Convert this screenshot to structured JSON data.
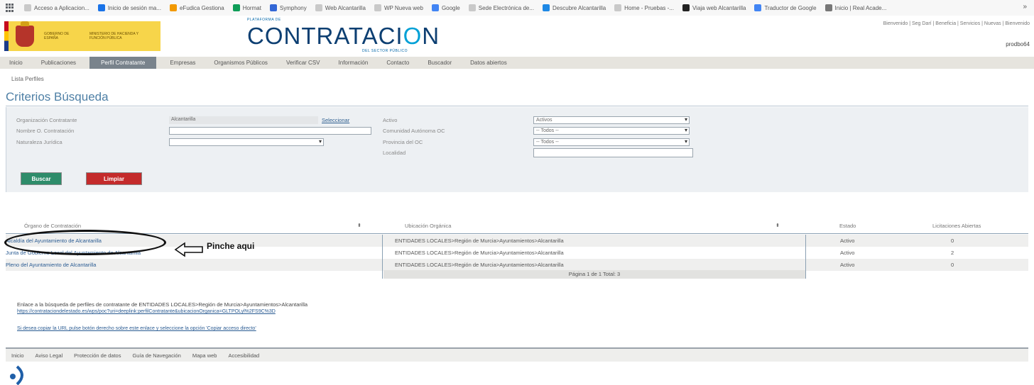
{
  "bookmarks": [
    {
      "label": "Acceso a Aplicacion...",
      "color": "#c9c9c9"
    },
    {
      "label": "Inicio de sesión ma...",
      "color": "#1a73e8"
    },
    {
      "label": "eFudica Gestiona",
      "color": "#f29900"
    },
    {
      "label": "Hormat",
      "color": "#0f9d58"
    },
    {
      "label": "Symphony",
      "color": "#3367d6"
    },
    {
      "label": "Web Alcantarilla",
      "color": "#c9c9c9"
    },
    {
      "label": "WP Nueva web",
      "color": "#c9c9c9"
    },
    {
      "label": "Google",
      "color": "#4285f4"
    },
    {
      "label": "Sede Electrónica de...",
      "color": "#c9c9c9"
    },
    {
      "label": "Descubre Alcantarilla",
      "color": "#1e88e5"
    },
    {
      "label": "Home - Pruebas -...",
      "color": "#c9c9c9"
    },
    {
      "label": "Viaja web Alcantarilla",
      "color": "#222222"
    },
    {
      "label": "Traductor de Google",
      "color": "#4285f4"
    },
    {
      "label": "Inicio | Real Acade...",
      "color": "#777777"
    }
  ],
  "header": {
    "gov_line1": "GOBIERNO DE ESPAÑA",
    "gov_line2": "MINISTERIO DE HACIENDA Y FUNCIÓN PÚBLICA",
    "brand_top": "PLATAFORMA DE",
    "brand_main_a": "CONTRATACI",
    "brand_main_o": "O",
    "brand_main_b": "N",
    "brand_sub": "DEL SECTOR PÚBLICO",
    "welcome": "Bienvenido | Seg Darí | Beneficia | Servicios | Nuevas | Bienvenido",
    "username": "prodbo64"
  },
  "nav": [
    "Inicio",
    "Publicaciones",
    "Perfil Contratante",
    "Empresas",
    "Organismos Públicos",
    "Verificar CSV",
    "Información",
    "Contacto",
    "Buscador",
    "Datos abiertos"
  ],
  "nav_active": "Perfil Contratante",
  "breadcrumb": "Lista Perfiles",
  "title": "Criterios Búsqueda",
  "form": {
    "org_label": "Organización Contratante",
    "org_value": "Alcantarilla",
    "select_link": "Seleccionar",
    "name_label": "Nombre O. Contratación",
    "nature_label": "Naturaleza Jurídica",
    "active_label": "Activo",
    "active_value": "Activos",
    "community_label": "Comunidad Autónoma OC",
    "community_value": "-- Todos --",
    "province_label": "Provincia del OC",
    "province_value": "-- Todos --",
    "locality_label": "Localidad",
    "search_button": "Buscar",
    "clear_button": "Limpiar"
  },
  "table": {
    "columns": [
      "Órgano de Contratación",
      "Ubicación Orgánica",
      "Estado",
      "Licitaciones Abiertas"
    ],
    "rows": [
      {
        "organo": "Alcaldía del Ayuntamiento de Alcantarilla",
        "ubicacion": "ENTIDADES LOCALES>Región de Murcia>Ayuntamientos>Alcantarilla",
        "estado": "Activo",
        "licitaciones": "0"
      },
      {
        "organo": "Junta de Gobierno Local del Ayuntamiento de Alcantarilla",
        "ubicacion": "ENTIDADES LOCALES>Región de Murcia>Ayuntamientos>Alcantarilla",
        "estado": "Activo",
        "licitaciones": "2"
      },
      {
        "organo": "Pleno del Ayuntamiento de Alcantarilla",
        "ubicacion": "ENTIDADES LOCALES>Región de Murcia>Ayuntamientos>Alcantarilla",
        "estado": "Activo",
        "licitaciones": "0"
      }
    ],
    "pager": "Página 1 de 1 Total: 3"
  },
  "annotation": "Pinche aqui",
  "info": {
    "text": "Enlace a la búsqueda de perfiles de contratante de ENTIDADES LOCALES>Región de Murcia>Ayuntamientos>Alcantarilla",
    "url": "https://contrataciondelestado.es/wps/poc?uri=deeplink:perfilContratante&ubicacionOrganica=GLTPOLyl%2FS9C%3D",
    "note": "Si desea copiar la URL pulse botón derecho sobre este enlace y seleccione la opción 'Copiar acceso directo'"
  },
  "footer": [
    "Inicio",
    "Aviso Legal",
    "Protección de datos",
    "Guía de Navegación",
    "Mapa web",
    "Accesibilidad"
  ]
}
